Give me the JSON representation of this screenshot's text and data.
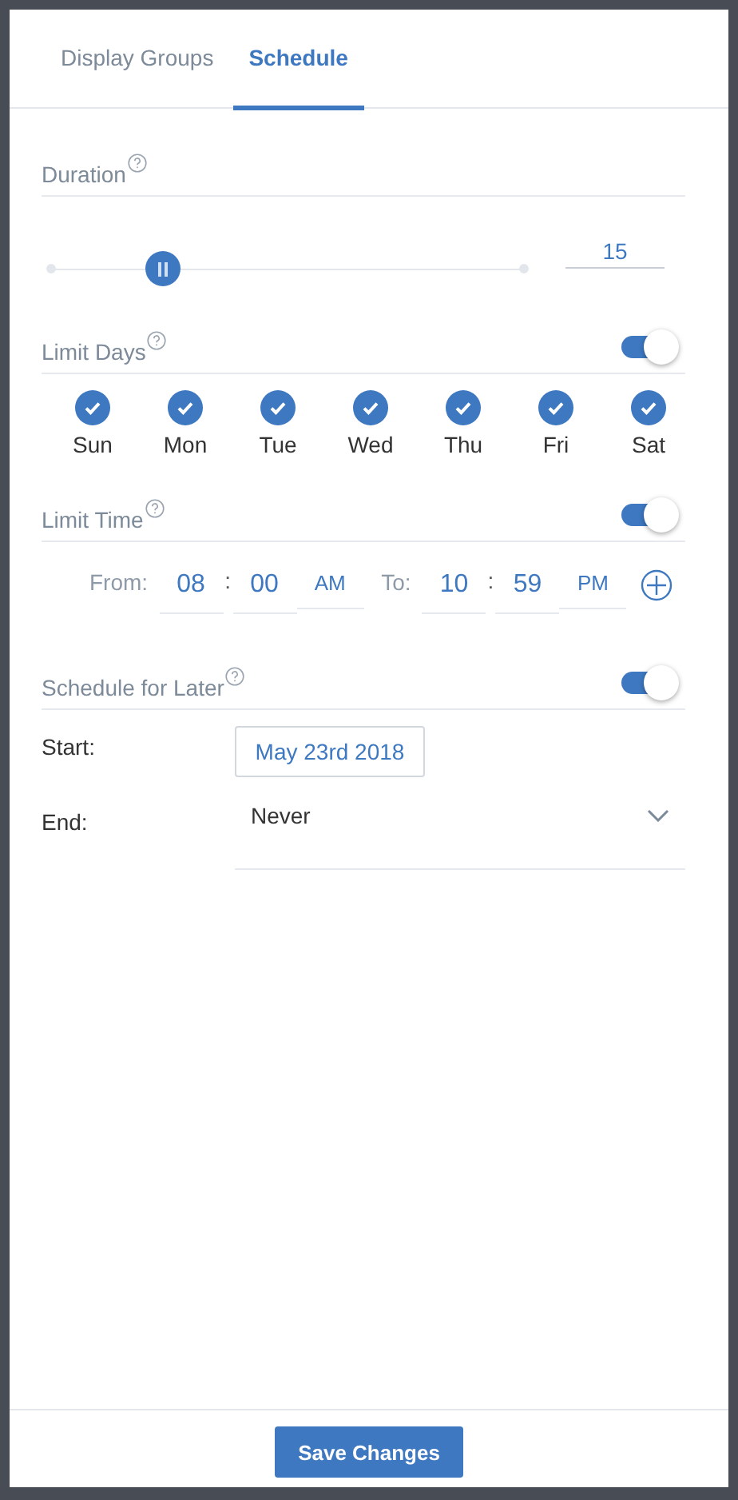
{
  "tabs": [
    {
      "label": "Display Groups",
      "selected": false
    },
    {
      "label": "Schedule",
      "selected": true
    }
  ],
  "duration": {
    "label": "Duration",
    "level": 0.235,
    "value": "15"
  },
  "limit_days": {
    "label": "Limit Days",
    "on": true,
    "days": [
      {
        "label": "Sun",
        "checked": true
      },
      {
        "label": "Mon",
        "checked": true
      },
      {
        "label": "Tue",
        "checked": true
      },
      {
        "label": "Wed",
        "checked": true
      },
      {
        "label": "Thu",
        "checked": true
      },
      {
        "label": "Fri",
        "checked": true
      },
      {
        "label": "Sat",
        "checked": true
      }
    ]
  },
  "limit_time": {
    "label": "Limit Time",
    "on": true,
    "from_label": "From:",
    "from": {
      "hour": "08",
      "separator": ":",
      "minute": "00",
      "period": "AM"
    },
    "to_label": "To:",
    "to": {
      "hour": "10",
      "separator": ":",
      "minute": "59",
      "period": "PM"
    }
  },
  "schedule_later": {
    "label": "Schedule for Later",
    "on": true,
    "start_label": "Start:",
    "start_date": "May 23rd 2018",
    "end_label": "End:",
    "end_value": "Never"
  },
  "save_button": "Save Changes"
}
